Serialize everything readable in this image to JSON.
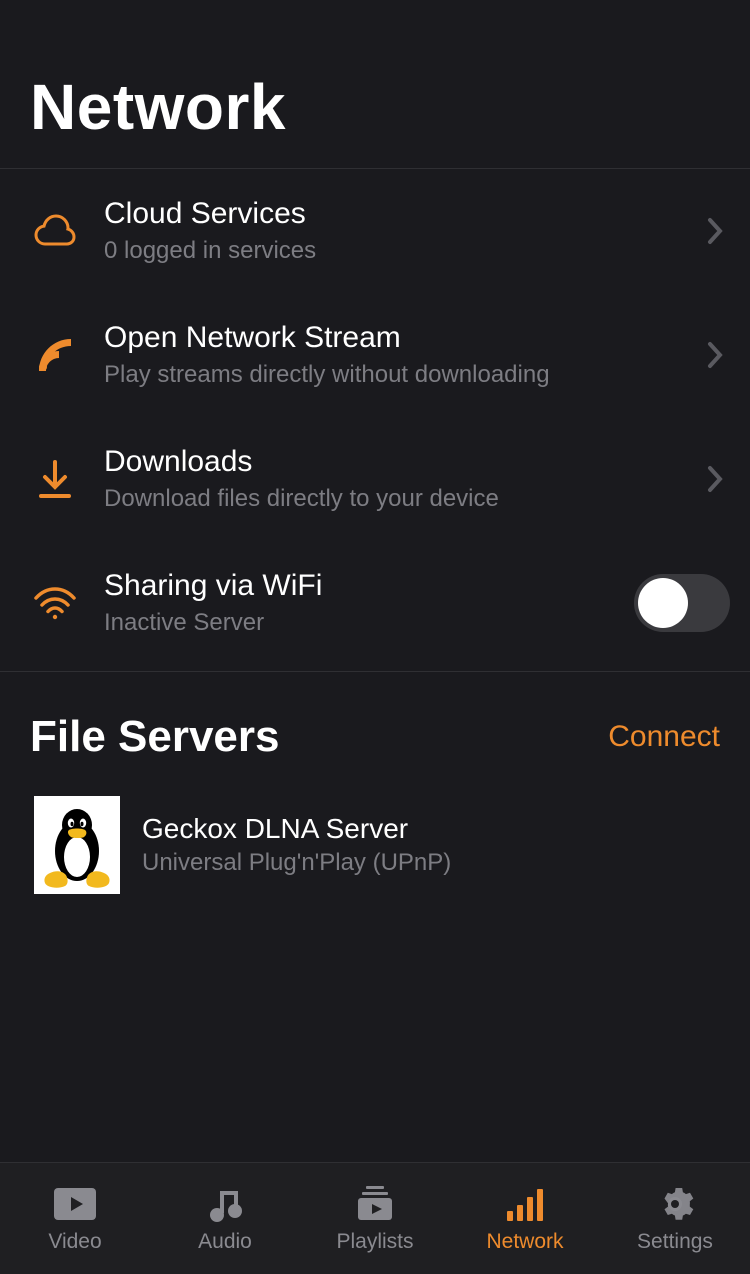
{
  "header": {
    "title": "Network"
  },
  "items": [
    {
      "icon": "cloud-icon",
      "title": "Cloud Services",
      "sub": "0 logged in services",
      "trailing": "chevron"
    },
    {
      "icon": "stream-icon",
      "title": "Open Network Stream",
      "sub": "Play streams directly without downloading",
      "trailing": "chevron"
    },
    {
      "icon": "download-icon",
      "title": "Downloads",
      "sub": "Download files directly to your device",
      "trailing": "chevron"
    },
    {
      "icon": "wifi-icon",
      "title": "Sharing via WiFi",
      "sub": "Inactive Server",
      "trailing": "toggle",
      "toggle": false
    }
  ],
  "servers": {
    "heading": "File Servers",
    "action": "Connect",
    "list": [
      {
        "icon": "tux-icon",
        "title": "Geckox DLNA Server",
        "sub": "Universal Plug'n'Play (UPnP)"
      }
    ]
  },
  "tabs": [
    {
      "icon": "video-icon",
      "label": "Video",
      "active": false
    },
    {
      "icon": "audio-icon",
      "label": "Audio",
      "active": false
    },
    {
      "icon": "playlist-icon",
      "label": "Playlists",
      "active": false
    },
    {
      "icon": "network-icon",
      "label": "Network",
      "active": true
    },
    {
      "icon": "settings-icon",
      "label": "Settings",
      "active": false
    }
  ],
  "colors": {
    "accent": "#ee8b2d"
  }
}
